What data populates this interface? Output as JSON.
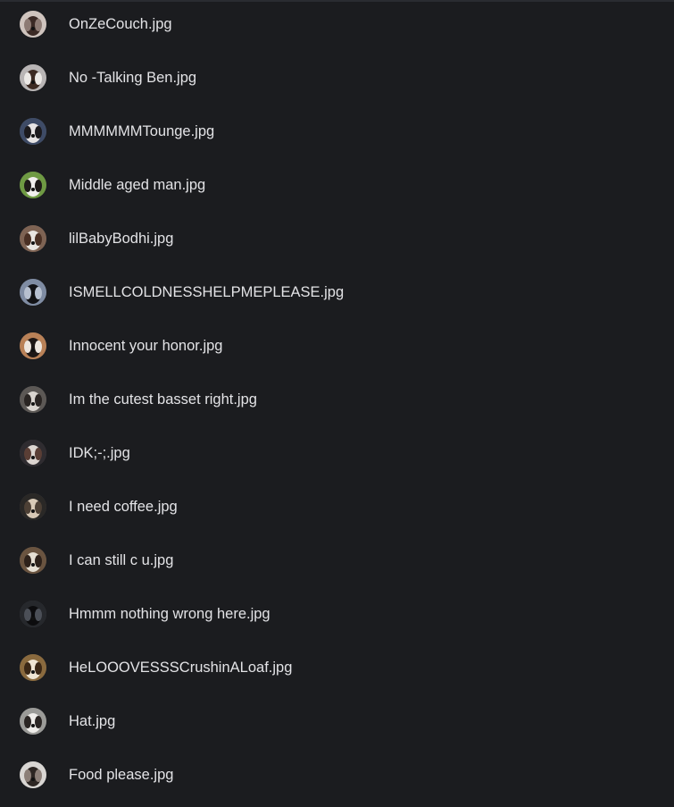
{
  "files": [
    {
      "name": "OnZeCouch.jpg",
      "thumb_icon": "dog-photo-icon",
      "colors": [
        "#cfc4be",
        "#3b2a25",
        "#8d7b74"
      ]
    },
    {
      "name": "No -Talking Ben.jpg",
      "thumb_icon": "dog-photo-icon",
      "colors": [
        "#b9b5b5",
        "#3d2a22",
        "#ece9e6"
      ]
    },
    {
      "name": "MMMMMMTounge.jpg",
      "thumb_icon": "dog-photo-icon",
      "colors": [
        "#3e4b66",
        "#e7e4e4",
        "#1c1a1d"
      ]
    },
    {
      "name": "Middle aged man.jpg",
      "thumb_icon": "dog-photo-icon",
      "colors": [
        "#6f9a43",
        "#f1efee",
        "#1e1a19"
      ]
    },
    {
      "name": "lilBabyBodhi.jpg",
      "thumb_icon": "dog-photo-icon",
      "colors": [
        "#7e6353",
        "#e9e6e2",
        "#4a3024"
      ]
    },
    {
      "name": "ISMELLCOLDNESSHELPMEPLEASE.jpg",
      "thumb_icon": "dog-photo-icon",
      "colors": [
        "#7f8ca3",
        "#121215",
        "#b7c0cf"
      ]
    },
    {
      "name": "Innocent your honor.jpg",
      "thumb_icon": "dog-photo-icon",
      "colors": [
        "#b98157",
        "#1d1716",
        "#ede6df"
      ]
    },
    {
      "name": "Im the cutest basset right.jpg",
      "thumb_icon": "dog-photo-icon",
      "colors": [
        "#5c5855",
        "#d9d4cf",
        "#2a2523"
      ]
    },
    {
      "name": "IDK;-;.jpg",
      "thumb_icon": "dog-photo-icon",
      "colors": [
        "#2f2c30",
        "#dcd5d0",
        "#5a3e35"
      ]
    },
    {
      "name": "I need coffee.jpg",
      "thumb_icon": "dog-photo-icon",
      "colors": [
        "#2a2826",
        "#d8c9b6",
        "#4d4035"
      ]
    },
    {
      "name": "I can still c u.jpg",
      "thumb_icon": "dog-photo-icon",
      "colors": [
        "#6a5440",
        "#e6dfd3",
        "#2e221b"
      ]
    },
    {
      "name": "Hmmm nothing wrong here.jpg",
      "thumb_icon": "dog-photo-icon",
      "colors": [
        "#26282c",
        "#0c0c0e",
        "#4b4f57"
      ]
    },
    {
      "name": "HeLOOOVESSSCrushinALoaf.jpg",
      "thumb_icon": "dog-photo-icon",
      "colors": [
        "#8a6a3e",
        "#efe5d4",
        "#3a2716"
      ]
    },
    {
      "name": "Hat.jpg",
      "thumb_icon": "dog-photo-icon",
      "colors": [
        "#9b9b98",
        "#efedea",
        "#2b2624"
      ]
    },
    {
      "name": "Food please.jpg",
      "thumb_icon": "dog-photo-icon",
      "colors": [
        "#d9d6d3",
        "#2d2623",
        "#8c7f78"
      ]
    }
  ]
}
